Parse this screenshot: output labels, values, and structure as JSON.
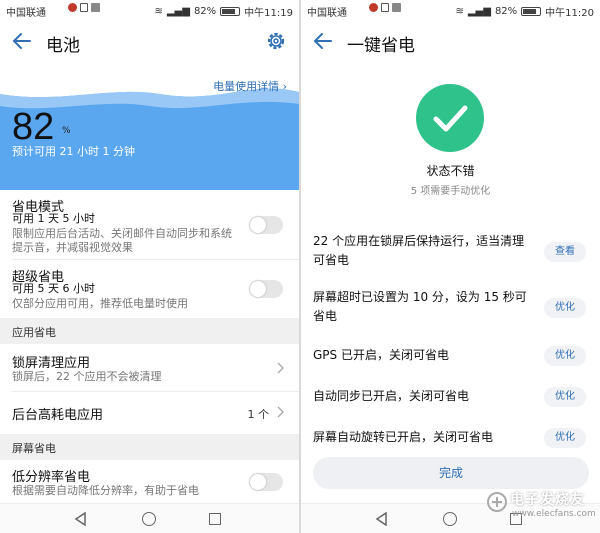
{
  "statusbar_left": {
    "carrier": "中国联通",
    "battery": "82%",
    "time": "中午11:19"
  },
  "statusbar_right": {
    "carrier": "中国联通",
    "battery": "82%",
    "time": "中午11:20"
  },
  "battery_screen": {
    "title": "电池",
    "usage_link": "电量使用详情",
    "percent": "82",
    "percent_sign": "%",
    "estimate": "预计可用 21 小时 1 分钟",
    "power_saving": {
      "title": "省电模式",
      "duration": "可用 1 天 5 小时",
      "desc_line1": "限制应用后台活动、关闭邮件自动同步和系统",
      "desc_line2": "提示音，并减弱视觉效果"
    },
    "ultra_saving": {
      "title": "超级省电",
      "duration": "可用 5 天 6 小时",
      "desc": "仅部分应用可用，推荐低电量时使用"
    },
    "section_app": "应用省电",
    "lock_clean": {
      "title": "锁屏清理应用",
      "desc": "锁屏后，22 个应用不会被清理"
    },
    "background_high": {
      "title": "后台高耗电应用",
      "count": "1 个"
    },
    "section_screen": "屏幕省电",
    "low_res": {
      "title": "低分辨率省电",
      "desc": "根据需要自动降低分辨率，有助于省电"
    }
  },
  "optimize_screen": {
    "title": "一键省电",
    "status_title": "状态不错",
    "status_sub": "5 项需要手动优化",
    "tips": [
      {
        "text": "22 个应用在锁屏后保持运行，适当清理可省电",
        "button": "查看"
      },
      {
        "text": "屏幕超时已设置为 10 分，设为 15 秒可省电",
        "button": "优化"
      },
      {
        "text": "GPS 已开启，关闭可省电",
        "button": "优化"
      },
      {
        "text": "自动同步已开启，关闭可省电",
        "button": "优化"
      },
      {
        "text": "屏幕自动旋转已开启，关闭可省电",
        "button": "优化"
      }
    ],
    "done": "完成",
    "watermark": "电子发烧友",
    "watermark_url": "www.elecfans.com"
  },
  "colors": {
    "accent": "#2f6fb4",
    "hero_blue": "#5aa7f0",
    "success_green": "#2fc28a"
  },
  "icons": [
    "back-arrow-icon",
    "gear-icon",
    "chevron-right-icon",
    "checkmark-icon",
    "nav-back-icon",
    "nav-home-icon",
    "nav-recent-icon"
  ]
}
